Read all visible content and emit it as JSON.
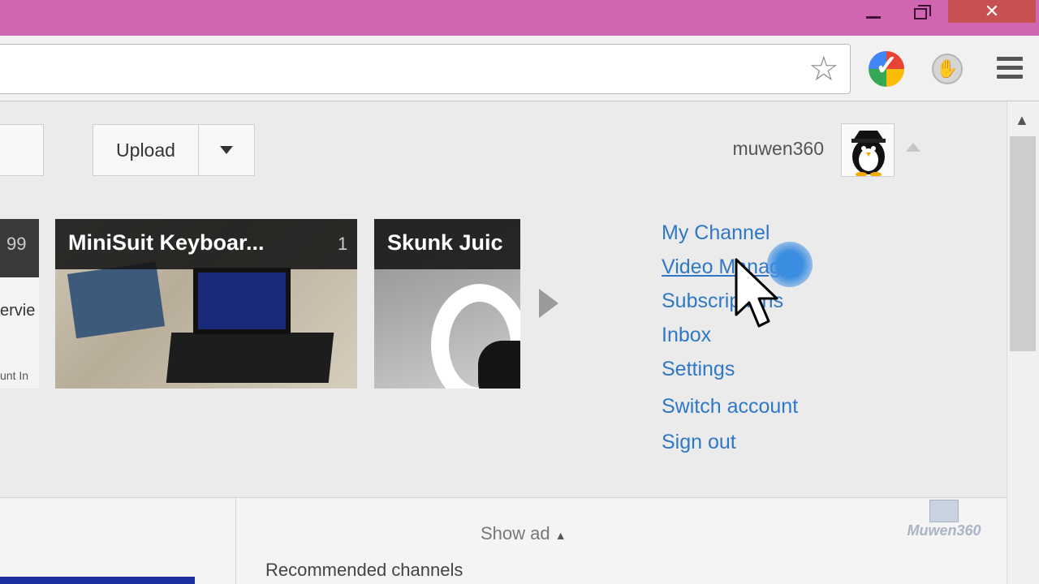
{
  "window": {
    "minimize_icon": "minimize-icon",
    "restore_icon": "restore-icon",
    "close_glyph": "✕"
  },
  "toolbar": {
    "star_glyph": "☆",
    "menu_icon": "hamburger-menu-icon"
  },
  "header": {
    "upload_label": "Upload",
    "username": "muwen360"
  },
  "videos": [
    {
      "title": "",
      "count": "99",
      "side_text": "ervie",
      "side_text2": "unt In"
    },
    {
      "title": "MiniSuit Keyboar...",
      "count": "1"
    },
    {
      "title": "Skunk Juic",
      "count": ""
    }
  ],
  "account_menu": {
    "items": [
      "My Channel",
      "Video Manager",
      "Subscriptions",
      "Inbox",
      "Settings",
      "Switch account",
      "Sign out"
    ]
  },
  "bottom": {
    "show_ad": "Show ad",
    "show_ad_arrow": "▲",
    "recommended": "Recommended channels"
  },
  "watermark": {
    "text": "Muwen360"
  },
  "colors": {
    "titlebar": "#d066b2",
    "link": "#2f78c8",
    "close": "#c75050"
  }
}
